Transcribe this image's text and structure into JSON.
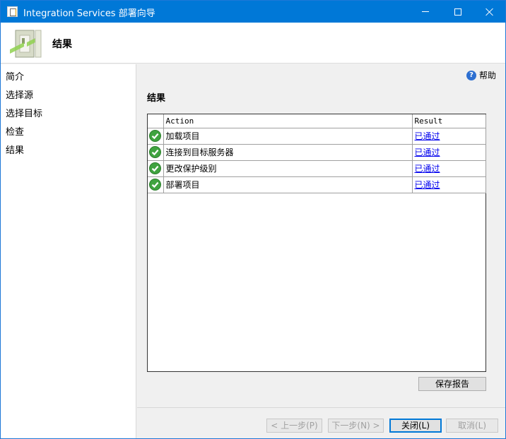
{
  "window": {
    "title": "Integration Services 部署向导",
    "accent": "#0078d7"
  },
  "header": {
    "title": "结果",
    "icon": "wizard-icon"
  },
  "sidebar": {
    "items": [
      {
        "label": "简介"
      },
      {
        "label": "选择源"
      },
      {
        "label": "选择目标"
      },
      {
        "label": "检查"
      },
      {
        "label": "结果"
      }
    ]
  },
  "help": {
    "label": "帮助",
    "icon": "help-icon"
  },
  "main": {
    "section_title": "结果",
    "table": {
      "columns": [
        "",
        "Action",
        "Result"
      ],
      "rows": [
        {
          "status": "success-icon",
          "action": "加载项目",
          "result": "已通过"
        },
        {
          "status": "success-icon",
          "action": "连接到目标服务器",
          "result": "已通过"
        },
        {
          "status": "success-icon",
          "action": "更改保护级别",
          "result": "已通过"
        },
        {
          "status": "success-icon",
          "action": "部署项目",
          "result": "已通过"
        }
      ]
    },
    "save_report_label": "保存报告"
  },
  "footer": {
    "prev_label": "< 上一步(P)",
    "next_label": "下一步(N) >",
    "close_label": "关闭(L)",
    "cancel_label": "取消(L)"
  }
}
